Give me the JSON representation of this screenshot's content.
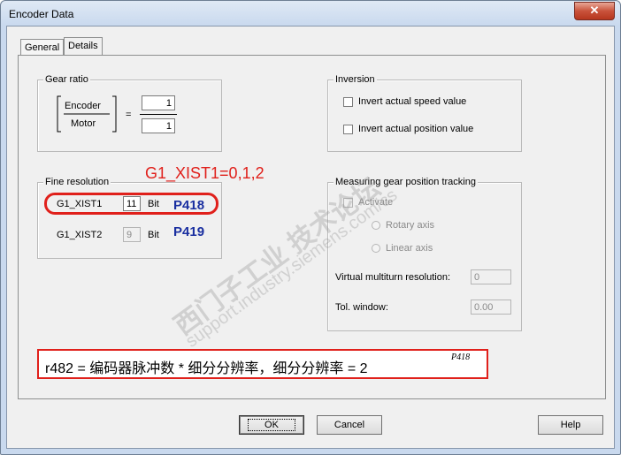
{
  "window": {
    "title": "Encoder Data",
    "close_glyph": "✕"
  },
  "tabs": [
    {
      "label": "General",
      "active": false
    },
    {
      "label": "Details",
      "active": true
    }
  ],
  "gear_ratio": {
    "legend": "Gear ratio",
    "encoder_label": "Encoder",
    "motor_label": "Motor",
    "equals": "=",
    "numerator": "1",
    "denominator": "1"
  },
  "inversion": {
    "legend": "Inversion",
    "invert_speed_label": "Invert actual speed value",
    "invert_position_label": "Invert actual position value"
  },
  "fine_resolution": {
    "legend": "Fine resolution",
    "xist1_label": "G1_XIST1",
    "xist1_value": "11",
    "xist1_unit": "Bit",
    "xist2_label": "G1_XIST2",
    "xist2_value": "9",
    "xist2_unit": "Bit"
  },
  "measuring": {
    "legend": "Measuring gear position tracking",
    "activate_label": "Activate",
    "rotary_label": "Rotary axis",
    "linear_label": "Linear axis",
    "virtual_multiturn_label": "Virtual multiturn resolution:",
    "virtual_multiturn_value": "0",
    "tol_window_label": "Tol. window:",
    "tol_window_value": "0.00"
  },
  "buttons": {
    "ok": "OK",
    "cancel": "Cancel",
    "help": "Help"
  },
  "annotations": {
    "xist_values": "G1_XIST1=0,1,2",
    "p418": "P418",
    "p419": "P419",
    "formula_text": "r482 = 编码器脉冲数 * 细分分辨率，细分分辨率 = 2",
    "formula_exponent": "P418",
    "red": "#e0201b",
    "blue": "#1a2fa0"
  },
  "watermark": {
    "cn": "西门子工业 技术论坛",
    "url": "support.industry.siemens.com/cs"
  }
}
